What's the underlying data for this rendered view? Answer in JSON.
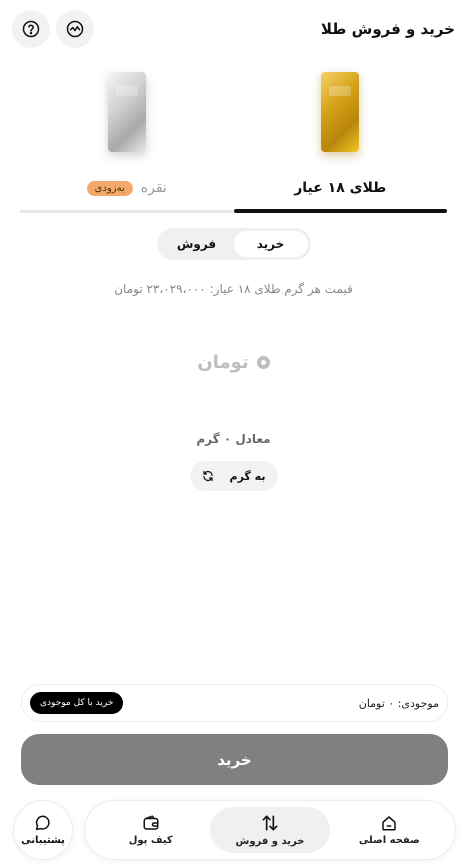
{
  "header": {
    "title": "خرید و فروش طلا"
  },
  "icons": {
    "help": "help-circle-icon",
    "activity": "activity-icon"
  },
  "metal_tabs": [
    {
      "label": "طلای ۱۸ عیار",
      "active": true
    },
    {
      "label": "نقره",
      "badge": "به‌زودی",
      "active": false
    }
  ],
  "toggle": {
    "buy": "خرید",
    "sell": "فروش",
    "selected": "buy"
  },
  "price_line": "قیمت هر گرم طلای ۱۸ عیار: ۲۳،۰۲۹،۰۰۰ تومان",
  "amount": {
    "unit": "تومان"
  },
  "equivalent": "معادل ۰ گرم",
  "unit_switch": {
    "label": "به گرم"
  },
  "balance": {
    "text": "موجودی: ۰ تومان",
    "buy_all": "خرید با کل موجودی"
  },
  "primary_button": "خرید",
  "bottom_nav": {
    "items": [
      {
        "label": "صفحه اصلی",
        "icon": "home-icon"
      },
      {
        "label": "خرید و فروش",
        "icon": "swap-vertical-icon",
        "active": true
      },
      {
        "label": "کیف پول",
        "icon": "wallet-icon"
      }
    ],
    "support": {
      "label": "پشتیبانی",
      "icon": "chat-bubble-icon"
    }
  },
  "colors": {
    "gold": "#d4a017",
    "badge": "#f4a96a",
    "primary_disabled": "#808080"
  }
}
